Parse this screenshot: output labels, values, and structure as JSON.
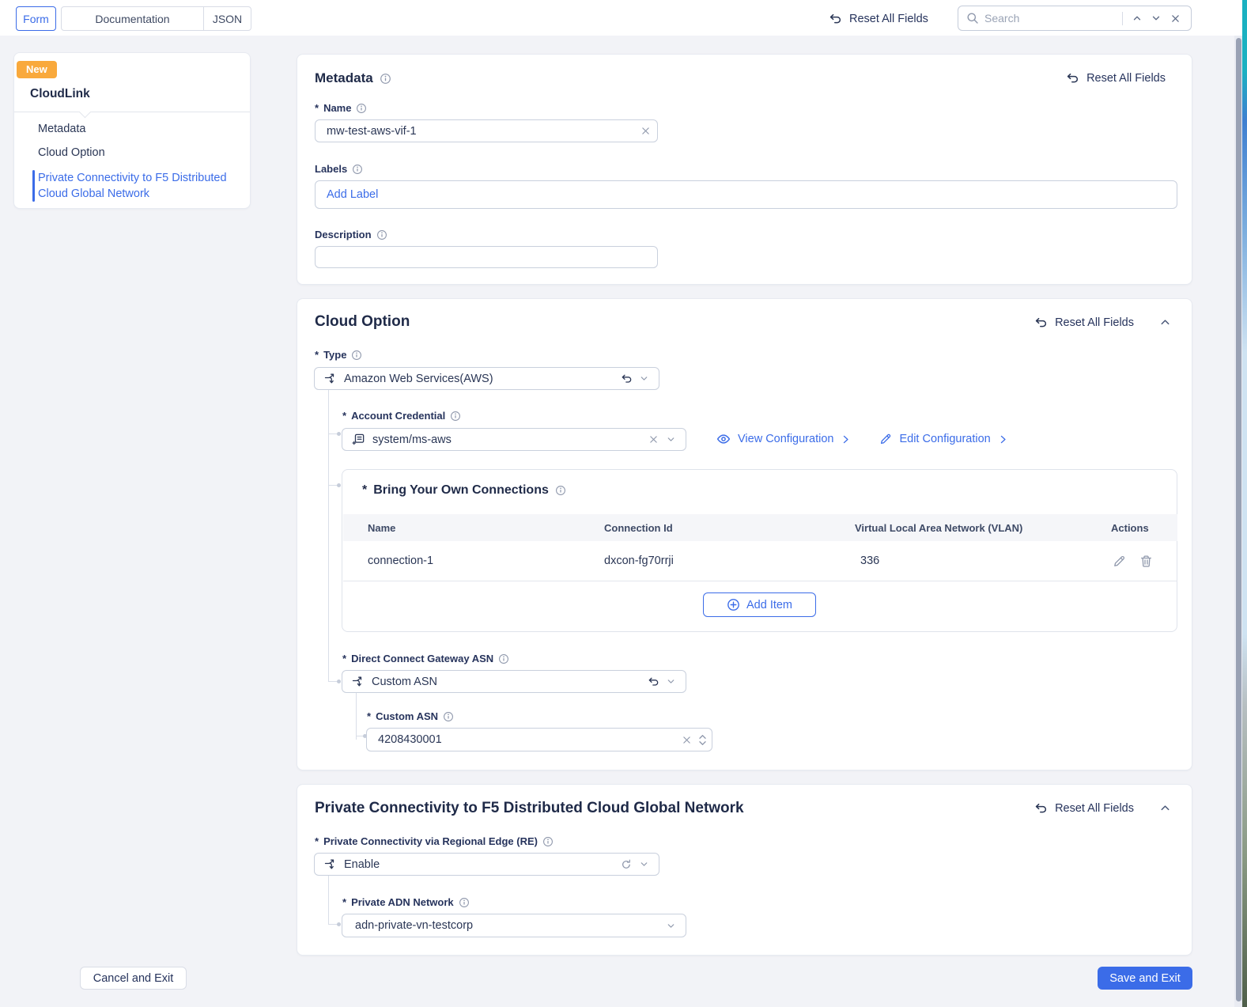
{
  "ui": {
    "reset_all_fields": "Reset All Fields",
    "required_marker": "*"
  },
  "header": {
    "tabs": {
      "form": "Form",
      "documentation": "Documentation",
      "json": "JSON"
    },
    "search_placeholder": "Search"
  },
  "sidebar": {
    "badge": "New",
    "title": "CloudLink",
    "items": [
      {
        "label": "Metadata"
      },
      {
        "label": "Cloud Option"
      },
      {
        "label": "Private Connectivity to F5 Distributed Cloud Global Network"
      }
    ]
  },
  "metadata": {
    "title": "Metadata",
    "name_label": "Name",
    "name_value": "mw-test-aws-vif-1",
    "labels_label": "Labels",
    "add_label_text": "Add Label",
    "description_label": "Description",
    "description_value": ""
  },
  "cloud": {
    "title": "Cloud Option",
    "type_label": "Type",
    "type_value": "Amazon Web Services(AWS)",
    "credential_label": "Account Credential",
    "credential_value": "system/ms-aws",
    "view_configuration": "View Configuration",
    "edit_configuration": "Edit Configuration",
    "byoc": {
      "title": "Bring Your Own Connections",
      "columns": [
        "Name",
        "Connection Id",
        "Virtual Local Area Network (VLAN)",
        "Actions"
      ],
      "rows": [
        {
          "name": "connection-1",
          "connection_id": "dxcon-fg70rrji",
          "vlan": "336"
        }
      ],
      "add_item_label": "Add Item"
    },
    "dcg_label": "Direct Connect Gateway ASN",
    "dcg_value": "Custom ASN",
    "custom_asn_label": "Custom ASN",
    "custom_asn_value": "4208430001"
  },
  "private_connectivity": {
    "title": "Private Connectivity to F5 Distributed Cloud Global Network",
    "re_label": "Private Connectivity via Regional Edge (RE)",
    "re_value": "Enable",
    "adn_label": "Private ADN Network",
    "adn_value": "adn-private-vn-testcorp"
  },
  "footer": {
    "cancel_label": "Cancel and Exit",
    "save_label": "Save and Exit"
  },
  "colors": {
    "accent_blue": "#3b6ce8",
    "badge_orange": "#f9a93c",
    "navy_text": "#232f54",
    "save_button": "#3b6ce8"
  }
}
